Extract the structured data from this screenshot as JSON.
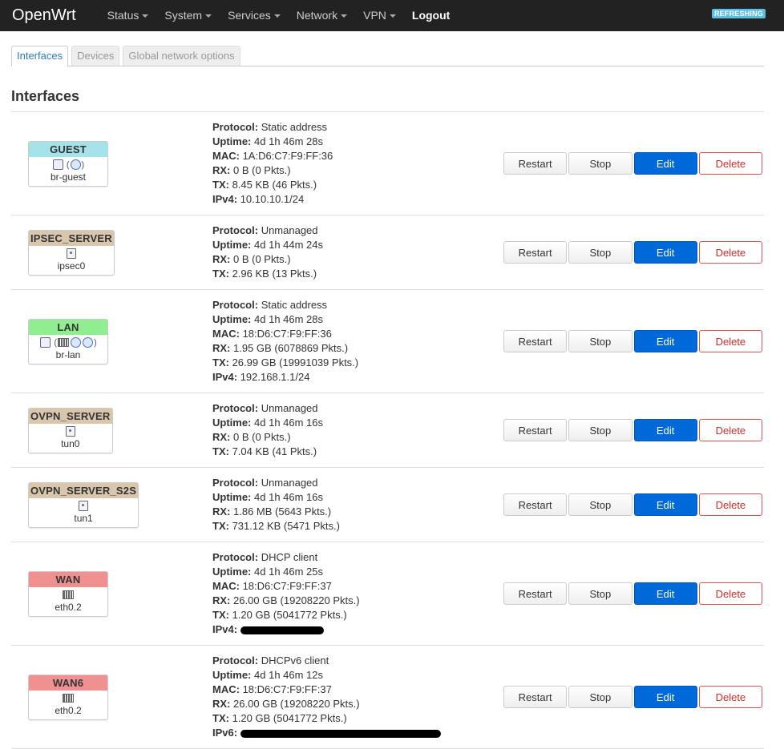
{
  "navbar": {
    "brand": "OpenWrt",
    "items": [
      {
        "label": "Status",
        "dropdown": true
      },
      {
        "label": "System",
        "dropdown": true
      },
      {
        "label": "Services",
        "dropdown": true
      },
      {
        "label": "Network",
        "dropdown": true
      },
      {
        "label": "VPN",
        "dropdown": true
      }
    ],
    "logout": "Logout",
    "badge": "REFRESHING"
  },
  "tabs": [
    {
      "label": "Interfaces",
      "active": true
    },
    {
      "label": "Devices",
      "active": false
    },
    {
      "label": "Global network options",
      "active": false
    }
  ],
  "section_title": "Interfaces",
  "labels": {
    "protocol": "Protocol:",
    "uptime": "Uptime:",
    "mac": "MAC:",
    "rx": "RX:",
    "tx": "TX:",
    "ipv4": "IPv4:",
    "ipv6": "IPv6:"
  },
  "buttons": {
    "restart": "Restart",
    "stop": "Stop",
    "edit": "Edit",
    "delete": "Delete"
  },
  "interfaces": [
    {
      "name": "GUEST",
      "color": "#a5e3ea",
      "device": "br-guest",
      "icons": [
        "bridge-icon",
        "wifi-icon"
      ],
      "protocol": "Static address",
      "uptime": "4d 1h 46m 28s",
      "mac": "1A:D6:C7:F9:FF:36",
      "rx": "0 B (0 Pkts.)",
      "tx": "8.45 KB (46 Pkts.)",
      "ipv4": "10.10.10.1/24"
    },
    {
      "name": "IPSEC_SERVER",
      "color": "#d8c6ad",
      "device": "ipsec0",
      "icons": [
        "tunnel-icon"
      ],
      "protocol": "Unmanaged",
      "uptime": "4d 1h 44m 24s",
      "rx": "0 B (0 Pkts.)",
      "tx": "2.96 KB (13 Pkts.)"
    },
    {
      "name": "LAN",
      "color": "#90ee90",
      "device": "br-lan",
      "icons": [
        "bridge-icon",
        "ethernet-icon",
        "wifi-icon",
        "wifi-icon"
      ],
      "protocol": "Static address",
      "uptime": "4d 1h 46m 28s",
      "mac": "18:D6:C7:F9:FF:36",
      "rx": "1.95 GB (6078869 Pkts.)",
      "tx": "26.99 GB (19991039 Pkts.)",
      "ipv4": "192.168.1.1/24"
    },
    {
      "name": "OVPN_SERVER",
      "color": "#d8c6ad",
      "device": "tun0",
      "icons": [
        "tunnel-icon"
      ],
      "protocol": "Unmanaged",
      "uptime": "4d 1h 46m 16s",
      "rx": "0 B (0 Pkts.)",
      "tx": "7.04 KB (41 Pkts.)"
    },
    {
      "name": "OVPN_SERVER_S2S",
      "color": "#d8c6ad",
      "device": "tun1",
      "icons": [
        "tunnel-icon"
      ],
      "protocol": "Unmanaged",
      "uptime": "4d 1h 46m 16s",
      "rx": "1.86 MB (5643 Pkts.)",
      "tx": "731.12 KB (5471 Pkts.)"
    },
    {
      "name": "WAN",
      "color": "#f09090",
      "device": "eth0.2",
      "icons": [
        "ethernet-icon"
      ],
      "protocol": "DHCP client",
      "uptime": "4d 1h 46m 25s",
      "mac": "18:D6:C7:F9:FF:37",
      "rx": "26.00 GB (19208220 Pkts.)",
      "tx": "1.20 GB (5041772 Pkts.)",
      "ipv4_redacted": true
    },
    {
      "name": "WAN6",
      "color": "#f09090",
      "device": "eth0.2",
      "icons": [
        "ethernet-icon"
      ],
      "protocol": "DHCPv6 client",
      "uptime": "4d 1h 46m 12s",
      "mac": "18:D6:C7:F9:FF:37",
      "rx": "26.00 GB (19208220 Pkts.)",
      "tx": "1.20 GB (5041772 Pkts.)",
      "ipv6_redacted": true
    }
  ]
}
